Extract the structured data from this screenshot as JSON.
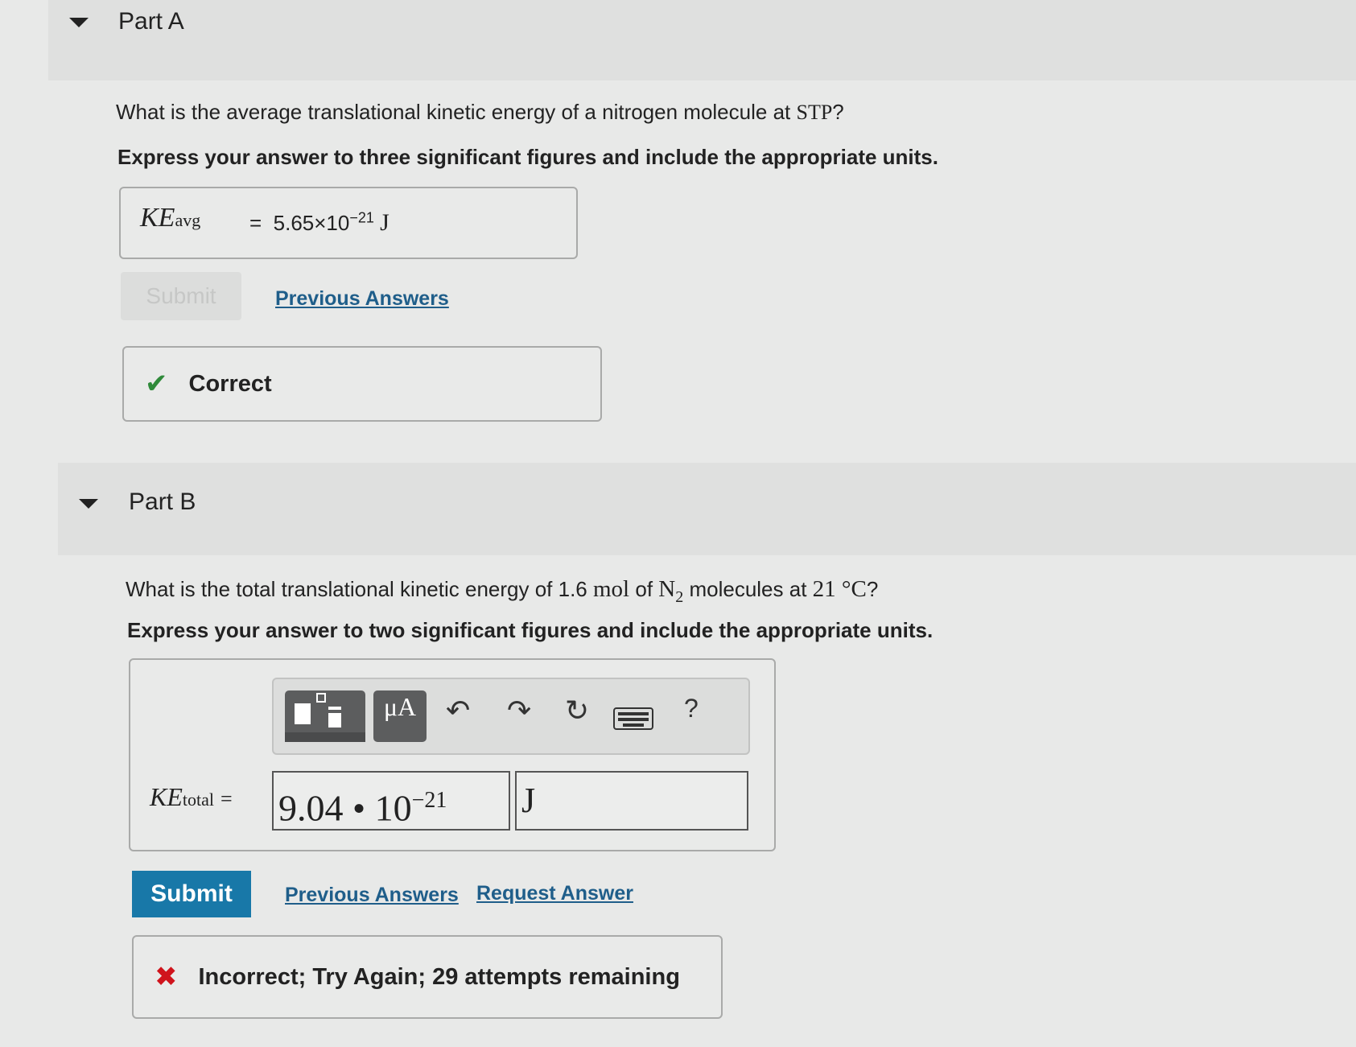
{
  "partA": {
    "title": "Part A",
    "question_pre": "What is the average translational kinetic energy of a nitrogen molecule at ",
    "question_term": "STP",
    "question_post": "?",
    "instruction": "Express your answer to three significant figures and include the appropriate units.",
    "answer_var": "KE",
    "answer_sub": "avg",
    "answer_eq": "=",
    "answer_mantissa": "5.65×10",
    "answer_exp": "−21",
    "answer_unit": "J",
    "submit_label": "Submit",
    "previous_answers": "Previous Answers",
    "feedback": "Correct"
  },
  "partB": {
    "title": "Part B",
    "question_1": "What is the total translational kinetic energy of 1.6",
    "question_unit": "mol",
    "question_2": "of",
    "question_species": "N",
    "question_species_sub": "2",
    "question_3": "molecules at",
    "question_temp": "21 °C",
    "question_end": "?",
    "instruction": "Express your answer to two significant figures and include the appropriate units.",
    "toolbar": {
      "units_label": "μA",
      "help_label": "?"
    },
    "answer_var": "KE",
    "answer_sub": "total",
    "answer_eq": "=",
    "answer_value": "9.04 • 10",
    "answer_exp": "−21",
    "answer_unit": "J",
    "submit_label": "Submit",
    "previous_answers": "Previous Answers",
    "request_answer": "Request Answer",
    "feedback": "Incorrect; Try Again; 29 attempts remaining"
  },
  "colors": {
    "link": "#1f5e8a",
    "submit_bg": "#1878a8",
    "correct": "#2f8a3a",
    "incorrect": "#d0141c"
  }
}
